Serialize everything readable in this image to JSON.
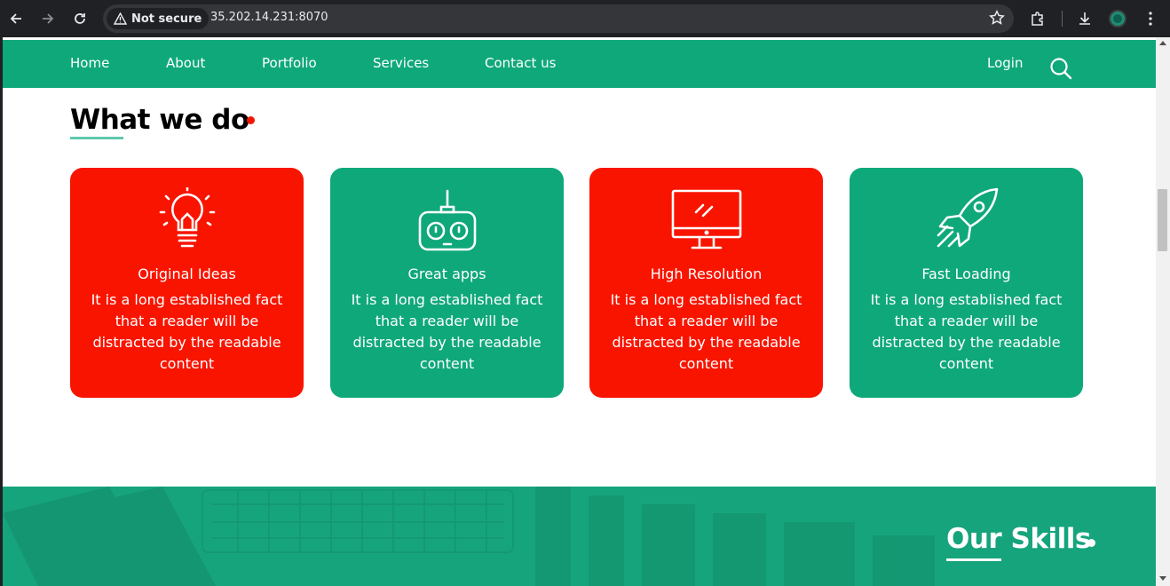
{
  "browser": {
    "security_chip": "Not secure",
    "url": "35.202.14.231:8070"
  },
  "nav": {
    "items": [
      {
        "label": "Home"
      },
      {
        "label": "About"
      },
      {
        "label": "Portfolio"
      },
      {
        "label": "Services"
      },
      {
        "label": "Contact us"
      }
    ],
    "login_label": "Login",
    "search_icon": "search-icon"
  },
  "what_we_do": {
    "title": "What we do",
    "cards": [
      {
        "icon": "lightbulb-icon",
        "title": "Original Ideas",
        "text": "It is a long established fact that a reader will be distracted by the readable content",
        "color": "#f91400"
      },
      {
        "icon": "remote-control-icon",
        "title": "Great apps",
        "text": "It is a long established fact that a reader will be distracted by the readable content",
        "color": "#0fa87a"
      },
      {
        "icon": "monitor-icon",
        "title": "High Resolution",
        "text": "It is a long established fact that a reader will be distracted by the readable content",
        "color": "#f91400"
      },
      {
        "icon": "rocket-icon",
        "title": "Fast Loading",
        "text": "It is a long established fact that a reader will be distracted by the readable content",
        "color": "#0fa87a"
      }
    ]
  },
  "skills": {
    "title_part1": "Our",
    "title_part2": " Skills"
  },
  "colors": {
    "brand_green": "#0fa87a",
    "accent_red": "#f91400",
    "underline": "#5fc8ae"
  }
}
